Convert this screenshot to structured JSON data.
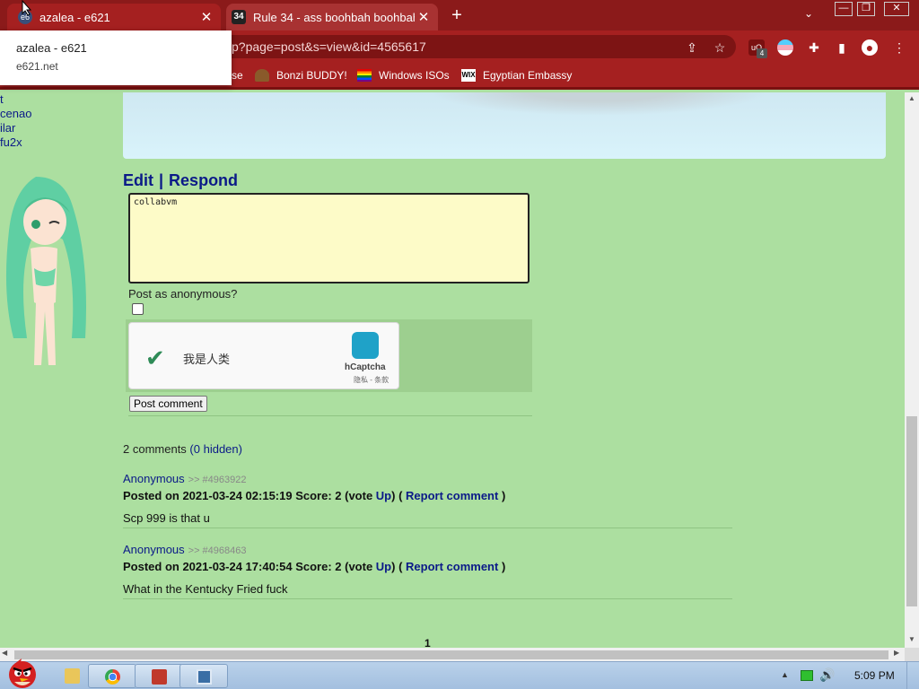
{
  "browser": {
    "tabs": [
      {
        "title": "azalea - e621",
        "favicon": "e6",
        "active": true
      },
      {
        "title": "Rule 34 - ass boohbah boohbah",
        "favicon": "34",
        "active": false
      }
    ],
    "new_tab": "+",
    "tab_search": "⌄",
    "window_controls": {
      "minimize": "—",
      "maximize": "❐",
      "close": "✕"
    },
    "url": "p?page=post&s=view&id=4565617",
    "extension_badge": "4",
    "ublock_label": "uO",
    "bookmarks": [
      {
        "label": "se",
        "icon": "bookmark-icon"
      },
      {
        "label": "Bonzi BUDDY!",
        "icon": "bonzi-icon"
      },
      {
        "label": "Windows ISOs",
        "icon": "rainbow-flag-icon"
      },
      {
        "label": "Egyptian Embassy",
        "icon": "wix-icon",
        "icon_text": "WIX"
      }
    ],
    "hover_card": {
      "title": "azalea - e621",
      "url": "e621.net"
    }
  },
  "page": {
    "tags": [
      "t",
      "cenao",
      "ilar",
      "fu2x"
    ],
    "actions": {
      "edit": "Edit",
      "separator": "|",
      "respond": "Respond"
    },
    "comment_input": {
      "value": "collabvm"
    },
    "anonymous_label": "Post as anonymous?",
    "captcha": {
      "label": "我是人类",
      "brand": "hCaptcha",
      "links": "隐私 - 条款"
    },
    "post_button": "Post comment",
    "comment_count_text": "2 comments ",
    "hidden_text": "(0 hidden)",
    "comments": [
      {
        "author": "Anonymous",
        "id": ">> #4963922",
        "posted_label": "Posted on 2021-03-24 02:15:19 Score: 2 (vote ",
        "vote_up": "Up",
        "after_vote": ") ( ",
        "report": "Report comment",
        "close": " )",
        "body": "Scp 999 is that u"
      },
      {
        "author": "Anonymous",
        "id": ">> #4968463",
        "posted_label": "Posted on 2021-03-24 17:40:54 Score: 2 (vote ",
        "vote_up": "Up",
        "after_vote": ") ( ",
        "report": "Report comment",
        "close": " )",
        "body": "What in the Kentucky Fried fuck"
      }
    ],
    "paginator": "1"
  },
  "taskbar": {
    "apps": [
      "explorer-icon",
      "chrome-icon",
      "pdf-icon",
      "vm-icon"
    ],
    "clock": "5:09 PM"
  },
  "colors": {
    "browser_frame": "#8b1a1a",
    "page_bg": "#acdfa0",
    "link": "#0b1a88",
    "comment_input_bg": "#fdfbc8"
  }
}
